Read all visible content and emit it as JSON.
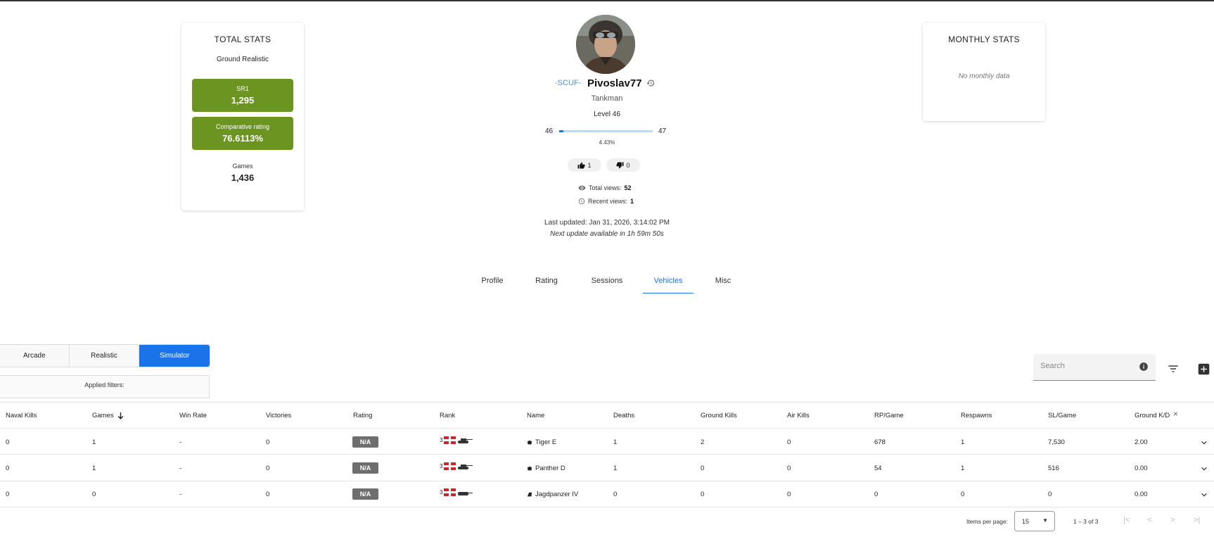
{
  "total_stats": {
    "title": "TOTAL STATS",
    "mode": "Ground Realistic",
    "sr1_label": "SR1",
    "sr1_value": "1,295",
    "cr_label": "Comparative rating",
    "cr_value": "76.6113%",
    "games_label": "Games",
    "games_value": "1,436",
    "accent_color": "#6b9420"
  },
  "monthly_stats": {
    "title": "MONTHLY STATS",
    "empty_text": "No monthly data"
  },
  "profile": {
    "squadron": "-SCUF-",
    "name": "Pivoslav77",
    "title": "Tankman",
    "level_text": "Level 46",
    "level_from": "46",
    "level_to": "47",
    "level_progress_pct": "4.43%",
    "level_progress_fraction": 0.0443,
    "likes": "1",
    "dislikes": "0",
    "total_views_label": "Total views:",
    "total_views": "52",
    "recent_views_label": "Recent views:",
    "recent_views": "1",
    "last_updated": "Last updated: Jan 31, 2026, 3:14:02 PM",
    "next_update": "Next update available in 1h 59m 50s"
  },
  "tabs": [
    {
      "label": "Profile",
      "active": false
    },
    {
      "label": "Rating",
      "active": false
    },
    {
      "label": "Sessions",
      "active": false
    },
    {
      "label": "Vehicles",
      "active": true
    },
    {
      "label": "Misc",
      "active": false
    }
  ],
  "modes": [
    {
      "label": "Arcade",
      "active": false
    },
    {
      "label": "Realistic",
      "active": false
    },
    {
      "label": "Simulator",
      "active": true
    }
  ],
  "filters_label": "Applied filters:",
  "search_placeholder": "Search",
  "table": {
    "columns": [
      "Naval Kills",
      "Games",
      "Win Rate",
      "Victories",
      "Rating",
      "Rank",
      "Name",
      "Deaths",
      "Ground Kills",
      "Air Kills",
      "RP/Game",
      "Respawns",
      "SL/Game",
      "Ground K/D"
    ],
    "rows": [
      {
        "naval_kills": "0",
        "games": "1",
        "win_rate": "-",
        "victories": "0",
        "rating": "N/A",
        "rank": "3",
        "name": "Tiger E",
        "deaths": "1",
        "ground_kills": "2",
        "air_kills": "0",
        "rp_game": "678",
        "respawns": "1",
        "sl_game": "7,530",
        "ground_kd": "2.00"
      },
      {
        "naval_kills": "0",
        "games": "1",
        "win_rate": "-",
        "victories": "0",
        "rating": "N/A",
        "rank": "3",
        "name": "Panther D",
        "deaths": "1",
        "ground_kills": "0",
        "air_kills": "0",
        "rp_game": "54",
        "respawns": "1",
        "sl_game": "516",
        "ground_kd": "0.00"
      },
      {
        "naval_kills": "0",
        "games": "0",
        "win_rate": "-",
        "victories": "0",
        "rating": "N/A",
        "rank": "3",
        "name": "Jagdpanzer IV",
        "deaths": "0",
        "ground_kills": "0",
        "air_kills": "0",
        "rp_game": "0",
        "respawns": "0",
        "sl_game": "0",
        "ground_kd": "0.00"
      }
    ]
  },
  "pagination": {
    "items_per_page_label": "Items per page:",
    "items_per_page": "15",
    "range": "1 – 3 of 3"
  },
  "colors": {
    "accent_blue": "#1a73e8",
    "badge_gray": "#6e6e6e"
  }
}
